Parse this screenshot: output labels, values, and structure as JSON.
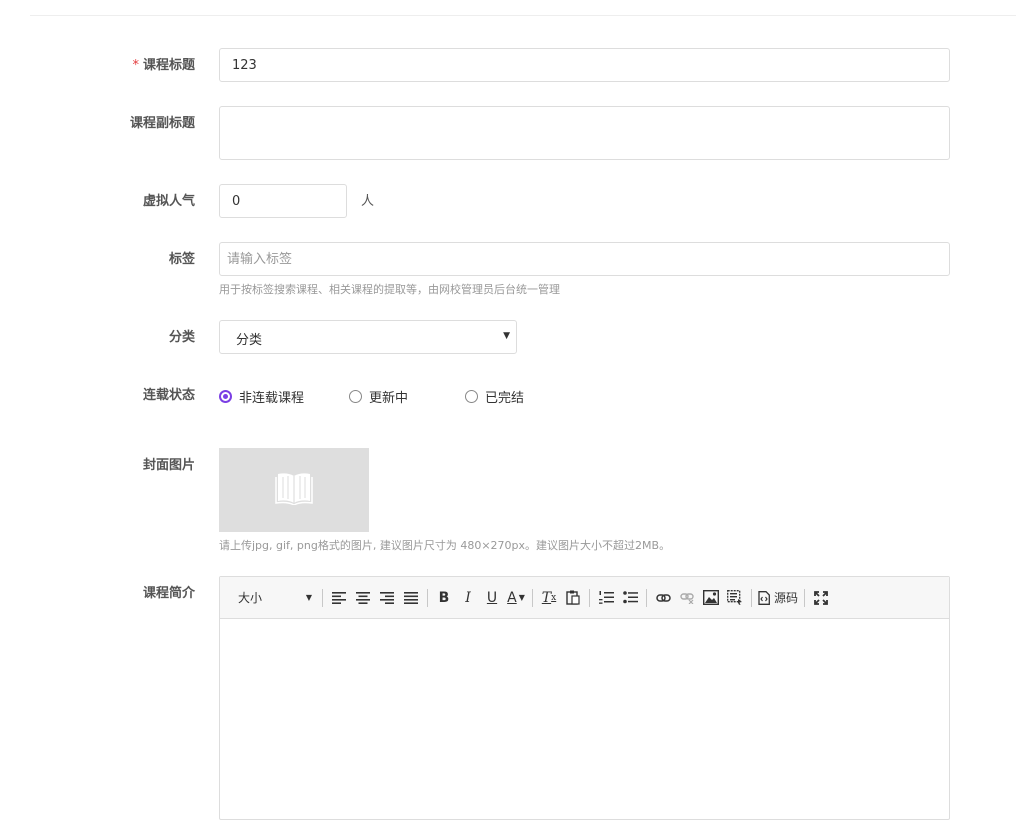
{
  "form": {
    "title": {
      "label": "课程标题",
      "required_mark": "*",
      "value": "123"
    },
    "subtitle": {
      "label": "课程副标题",
      "value": ""
    },
    "popularity": {
      "label": "虚拟人气",
      "value": "0",
      "unit": "人"
    },
    "tags": {
      "label": "标签",
      "placeholder": "请输入标签",
      "help": "用于按标签搜索课程、相关课程的提取等，由网校管理员后台统一管理"
    },
    "category": {
      "label": "分类",
      "selected": "分类"
    },
    "serial_status": {
      "label": "连载状态",
      "options": [
        {
          "label": "非连载课程",
          "checked": true
        },
        {
          "label": "更新中",
          "checked": false
        },
        {
          "label": "已完结",
          "checked": false
        }
      ]
    },
    "cover": {
      "label": "封面图片",
      "icon": "book-icon",
      "help": "请上传jpg, gif, png格式的图片, 建议图片尺寸为 480×270px。建议图片大小不超过2MB。"
    },
    "intro": {
      "label": "课程简介",
      "toolbar": {
        "font_size": "大小",
        "source_label": "源码",
        "buttons": [
          "align-left-icon",
          "align-center-icon",
          "align-right-icon",
          "align-justify-icon",
          "bold-icon",
          "italic-icon",
          "underline-icon",
          "text-color-icon",
          "remove-format-icon",
          "paste-text-icon",
          "ordered-list-icon",
          "unordered-list-icon",
          "link-icon",
          "unlink-icon",
          "image-icon",
          "template-icon",
          "source-icon",
          "fullscreen-icon"
        ]
      },
      "content": ""
    }
  },
  "colors": {
    "accent": "#7b3fe4",
    "required": "#e4393c",
    "border": "#dddddd",
    "placeholder_bg": "#dedede"
  }
}
